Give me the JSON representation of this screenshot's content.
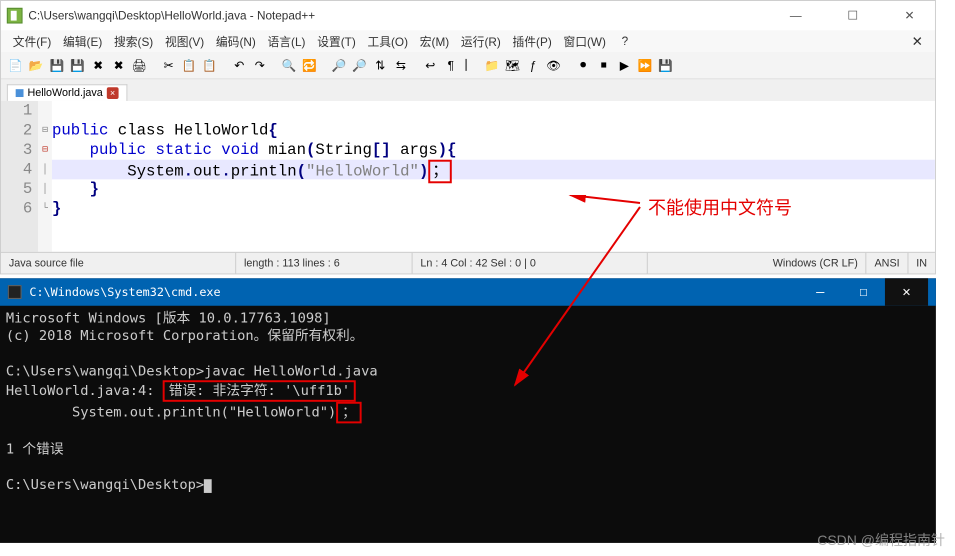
{
  "npp": {
    "title": "C:\\Users\\wangqi\\Desktop\\HelloWorld.java - Notepad++",
    "menu": [
      "文件(F)",
      "编辑(E)",
      "搜索(S)",
      "视图(V)",
      "编码(N)",
      "语言(L)",
      "设置(T)",
      "工具(O)",
      "宏(M)",
      "运行(R)",
      "插件(P)",
      "窗口(W)"
    ],
    "menu_q": "?",
    "tab": {
      "name": "HelloWorld.java"
    },
    "gutter": [
      "1",
      "2",
      "3",
      "4",
      "5",
      "6"
    ],
    "code": {
      "l2a": "public",
      "l2b": " class ",
      "l2c": "HelloWorld",
      "l2d": "{",
      "l3a": "    public",
      "l3b": " static ",
      "l3c": "void",
      "l3d": " mian",
      "l3e": "(",
      "l3f": "String",
      "l3g": "[] ",
      "l3h": "args",
      "l3i": ")",
      "l3j": "{",
      "l4a": "        System",
      "l4b": ".",
      "l4c": "out",
      "l4d": ".",
      "l4e": "println",
      "l4f": "(",
      "l4g": "\"HelloWorld\"",
      "l4h": ")",
      "l4i": "；",
      "l5": "    }",
      "l6": "}"
    },
    "status": {
      "type": "Java source file",
      "len": "length : 113    lines : 6",
      "pos": "Ln : 4    Col : 42    Sel : 0 | 0",
      "eol": "Windows (CR LF)",
      "enc": "ANSI",
      "ins": "IN"
    }
  },
  "cmd": {
    "title": "C:\\Windows\\System32\\cmd.exe",
    "l1": "Microsoft Windows [版本 10.0.17763.1098]",
    "l2": "(c) 2018 Microsoft Corporation。保留所有权利。",
    "l3": "C:\\Users\\wangqi\\Desktop>javac HelloWorld.java",
    "l4a": "HelloWorld.java:4: ",
    "l4b": "错误: 非法字符: '\\uff1b'",
    "l5a": "        System.out.println(\"HelloWorld\")",
    "l5b": "；",
    "l6": "                                         ^",
    "l7": "1 个错误",
    "l8": "C:\\Users\\wangqi\\Desktop>"
  },
  "annotation": "不能使用中文符号",
  "watermark": "CSDN @编程指南针"
}
